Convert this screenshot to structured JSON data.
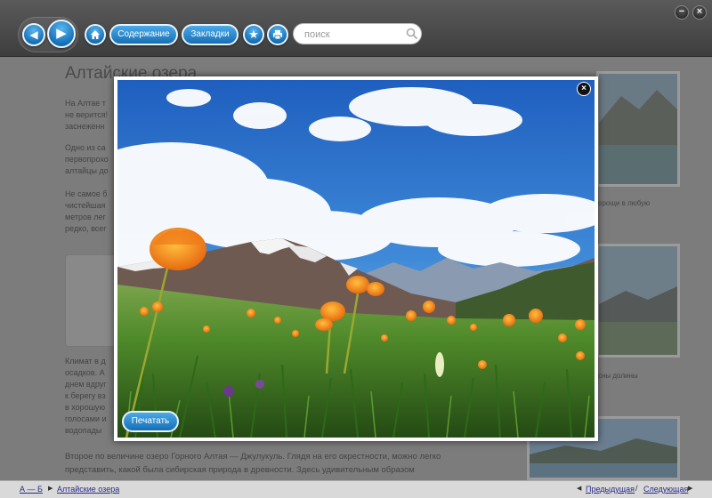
{
  "window": {
    "minimize_glyph": "−",
    "close_glyph": "×"
  },
  "toolbar": {
    "contents_label": "Содержание",
    "bookmarks_label": "Закладки",
    "search_placeholder": "поиск"
  },
  "article": {
    "title": "Алтайские озера",
    "fragments": [
      "На Алтае т",
      "не верится!",
      "заснеженн",
      "Одно из са",
      "первопрохо",
      "алтайцы до",
      "Не самое б",
      "чистейшая",
      "метров лег",
      "редко, всег"
    ],
    "bottom_fragments": [
      "Климат в д",
      "осадков. А",
      "днем вдруг",
      "к берегу вз",
      "в хорошую",
      "голосами и",
      "водопады"
    ],
    "bottom_paragraph_1": "Второе по величине озеро Горного Алтая — Джулукуль. Глядя на его окрестности, можно легко",
    "bottom_paragraph_2": "представить, какой была сибирская природа в древности. Здесь удивительным образом"
  },
  "sidebar": {
    "caption_1": "орощи в любую",
    "caption_2": "сны долины"
  },
  "modal": {
    "close_glyph": "×",
    "print_label": "Печатать"
  },
  "statusbar": {
    "index_link": "А — Б",
    "current_link": "Алтайские озера",
    "prev_link": "Предыдущая",
    "separator": "/",
    "next_link": "Следующая"
  },
  "colors": {
    "accent": "#1a7bc4",
    "toolbar": "#4a4a4a",
    "overlay": "#7c7c7c"
  }
}
